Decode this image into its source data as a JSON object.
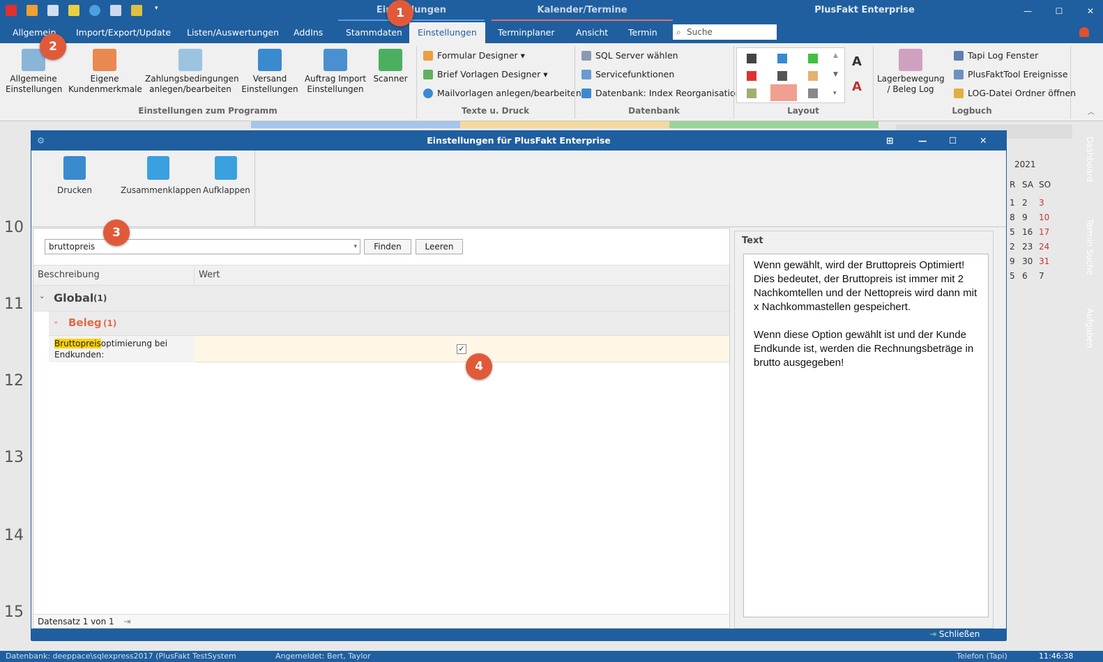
{
  "titlebar": {
    "context1": "Einstellungen",
    "context2": "Kalender/Termine",
    "app_title": "PlusFakt Enterprise"
  },
  "menu": {
    "tabs": [
      "Allgemein",
      "Import/Export/Update",
      "Listen/Auswertungen",
      "AddIns",
      "Stammdaten",
      "Einstellungen",
      "Terminplaner",
      "Ansicht",
      "Termin"
    ],
    "search_placeholder": "Suche"
  },
  "ribbon": {
    "big": [
      "Allgemeine\nEinstellungen",
      "Eigene\nKundenmerkmale",
      "Zahlungsbedingungen\nanlegen/bearbeiten",
      "Versand\nEinstellungen",
      "Auftrag Import\nEinstellungen",
      "Scanner"
    ],
    "group_programm": "Einstellungen zum Programm",
    "texte": [
      "Formular Designer",
      "Brief Vorlagen Designer",
      "Mailvorlagen anlegen/bearbeiten"
    ],
    "group_texte": "Texte u. Druck",
    "datenbank": [
      "SQL Server wählen",
      "Servicefunktionen",
      "Datenbank: Index Reorganisation"
    ],
    "group_datenbank": "Datenbank",
    "group_layout": "Layout",
    "lager": "Lagerbewegung\n/ Beleg Log",
    "logbuch": [
      "Tapi Log Fenster",
      "PlusFaktTool Ereignisse",
      "LOG-Datei Ordner öffnen"
    ],
    "group_logbuch": "Logbuch"
  },
  "dialog": {
    "title": "Einstellungen für PlusFakt Enterprise",
    "tools": [
      "Drucken",
      "Zusammenklappen",
      "Aufklappen"
    ],
    "search_value": "bruttopreis",
    "find": "Finden",
    "clear": "Leeren",
    "col_desc": "Beschreibung",
    "col_value": "Wert",
    "group_global": "Global",
    "group_global_count": "(1)",
    "group_beleg": "Beleg",
    "group_beleg_count": "(1)",
    "row_label_hl": "Bruttopreis",
    "row_label_rest": "optimierung bei Endkunden:",
    "row_checked": true,
    "record": "Datensatz 1 von 1",
    "text_header": "Text",
    "text_body": "Wenn gewählt, wird der Bruttopreis Optimiert!\nDies bedeutet, der Bruttopreis ist immer mit 2 Nachkomtellen und der Nettopreis wird dann mit x Nachkommastellen gespeichert.\n\nWenn diese Option gewählt ist und der Kunde Endkunde ist, werden die Rechnungsbeträge in brutto ausgegeben!"
  },
  "background": {
    "hours": [
      "10",
      "11",
      "12",
      "13",
      "14",
      "15"
    ],
    "year": "2021",
    "days_header": [
      "R",
      "SA",
      "SO"
    ],
    "cal_rows": [
      [
        "1",
        "2",
        "3"
      ],
      [
        "8",
        "9",
        "10"
      ],
      [
        "5",
        "16",
        "17"
      ],
      [
        "2",
        "23",
        "24"
      ],
      [
        "9",
        "30",
        "31"
      ],
      [
        "5",
        "6",
        "7"
      ]
    ]
  },
  "sidebar": [
    "Dashboard",
    "Termin Suche",
    "Aufgaben"
  ],
  "statusbar": {
    "close": "Schließen",
    "clock": "11:46:38",
    "left": "Datenbank: deeppace\\sqlexpress2017 (PlusFakt TestSystem",
    "mid": "Angemeldet: Bert, Taylor",
    "phone": "Telefon (Tapi)"
  },
  "badges": [
    "1",
    "2",
    "3",
    "4"
  ]
}
